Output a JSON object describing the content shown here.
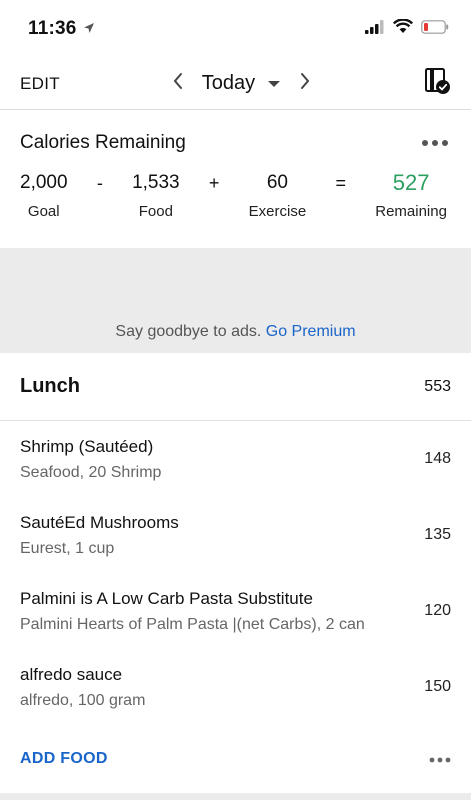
{
  "status": {
    "time": "11:36"
  },
  "nav": {
    "edit": "EDIT",
    "date": "Today"
  },
  "calories": {
    "title": "Calories Remaining",
    "goal_value": "2,000",
    "goal_label": "Goal",
    "minus": "-",
    "food_value": "1,533",
    "food_label": "Food",
    "plus": "+",
    "exercise_value": "60",
    "exercise_label": "Exercise",
    "equals": "=",
    "remaining_value": "527",
    "remaining_label": "Remaining"
  },
  "ad": {
    "text": "Say goodbye to ads.",
    "link": "Go Premium"
  },
  "meal": {
    "title": "Lunch",
    "total": "553",
    "items": [
      {
        "name": "Shrimp (Sautéed)",
        "detail": "Seafood, 20 Shrimp",
        "calories": "148"
      },
      {
        "name": "SautéEd Mushrooms",
        "detail": "Eurest, 1 cup",
        "calories": "135"
      },
      {
        "name": "Palmini is A Low Carb Pasta Substitute",
        "detail": "Palmini Hearts of Palm Pasta |(net Carbs), 2 can",
        "calories": "120"
      },
      {
        "name": "alfredo sauce",
        "detail": "alfredo, 100 gram",
        "calories": "150"
      }
    ],
    "add_label": "ADD FOOD"
  },
  "icons": {
    "location": "location-arrow-icon",
    "signal": "cellular-signal-icon",
    "wifi": "wifi-icon",
    "battery": "battery-icon",
    "prev": "chevron-left-icon",
    "next": "chevron-right-icon",
    "dropdown": "caret-down-icon",
    "complete": "complete-diary-icon",
    "more": "more-dots-icon"
  },
  "colors": {
    "accent": "#1a65c9",
    "remaining": "#2e9e61",
    "band": "#ebebeb",
    "battery_low": "#e53935"
  }
}
